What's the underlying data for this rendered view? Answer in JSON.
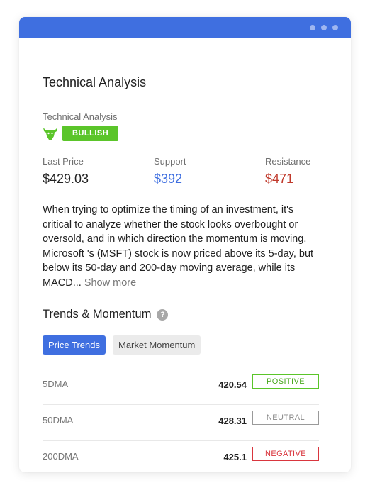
{
  "card": {
    "title": "Technical Analysis",
    "ta_label": "Technical Analysis",
    "signal": "BULLISH",
    "metrics": [
      {
        "label": "Last Price",
        "value": "$429.03"
      },
      {
        "label": "Support",
        "value": "$392"
      },
      {
        "label": "Resistance",
        "value": "$471"
      }
    ],
    "description": "When trying to optimize the timing of an investment, it's critical to analyze whether the stock looks overbought or oversold, and in which direction the momentum is moving. Microsoft 's (MSFT) stock is now priced above its 5-day, but below its 50-day and 200-day moving average, while its MACD... ",
    "show_more": "Show more"
  },
  "trends": {
    "title": "Trends & Momentum",
    "help": "?",
    "tabs": [
      "Price Trends",
      "Market Momentum"
    ],
    "rows": [
      {
        "name": "5DMA",
        "value": "420.54",
        "status": "POSITIVE"
      },
      {
        "name": "50DMA",
        "value": "428.31",
        "status": "NEUTRAL"
      },
      {
        "name": "200DMA",
        "value": "425.1",
        "status": "NEGATIVE"
      }
    ]
  },
  "colors": {
    "accent": "#3f6fe0",
    "positive": "#5bc52a",
    "negative": "#d9363e",
    "neutral": "#9a9a9a"
  }
}
